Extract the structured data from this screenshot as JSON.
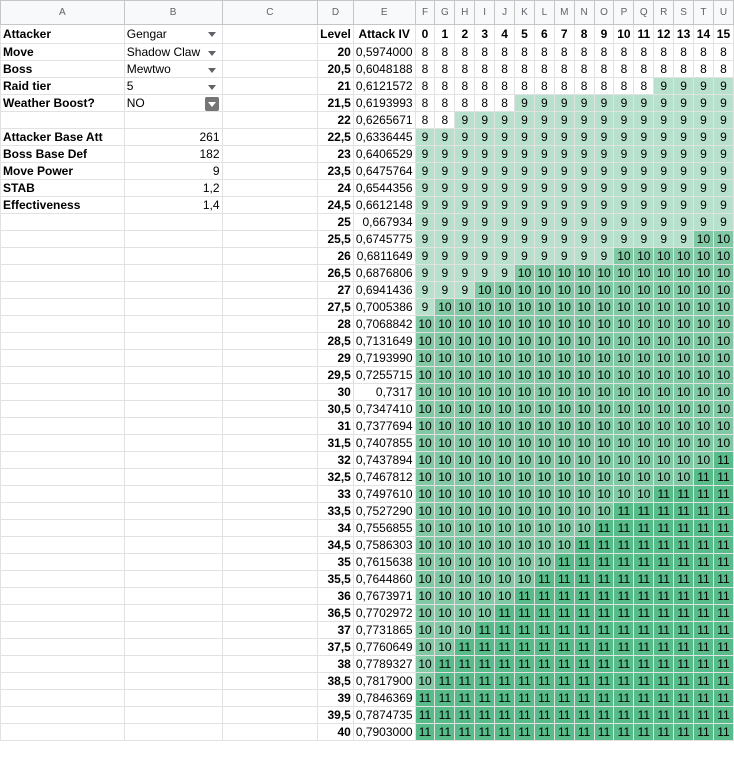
{
  "columns": [
    "A",
    "B",
    "C",
    "D",
    "E",
    "F",
    "G",
    "H",
    "I",
    "J",
    "K",
    "L",
    "M",
    "N",
    "O",
    "P",
    "Q",
    "R",
    "S",
    "T",
    "U"
  ],
  "params": [
    {
      "label": "Attacker",
      "value": "Gengar",
      "dropdown": true
    },
    {
      "label": "Move",
      "value": "Shadow Claw",
      "dropdown": true
    },
    {
      "label": "Boss",
      "value": "Mewtwo",
      "dropdown": true
    },
    {
      "label": "Raid tier",
      "value": "5",
      "dropdown": true
    },
    {
      "label": "Weather Boost?",
      "value": "NO",
      "dropdown": "boxed"
    },
    null,
    {
      "label": "Attacker Base Att",
      "value": "261",
      "numeric": true
    },
    {
      "label": "Boss Base Def",
      "value": "182",
      "numeric": true
    },
    {
      "label": "Move Power",
      "value": "9",
      "numeric": true
    },
    {
      "label": "STAB",
      "value": "1,2",
      "numeric": true
    },
    {
      "label": "Effectiveness",
      "value": "1,4",
      "numeric": true
    }
  ],
  "table_header": {
    "level": "Level",
    "multiplier": "Attack IV"
  },
  "iv_headers": [
    "0",
    "1",
    "2",
    "3",
    "4",
    "5",
    "6",
    "7",
    "8",
    "9",
    "10",
    "11",
    "12",
    "13",
    "14",
    "15"
  ],
  "thresholds": [
    16,
    16,
    12,
    5,
    2,
    0,
    0,
    0,
    0,
    0,
    0,
    0,
    0,
    0,
    0,
    0,
    0,
    0,
    0,
    0,
    0,
    0,
    0,
    0,
    0,
    0,
    0,
    0,
    0,
    0,
    0,
    0,
    0,
    0,
    0,
    0,
    0,
    0,
    0,
    0,
    0
  ],
  "thresholds_10": [
    16,
    16,
    16,
    16,
    16,
    16,
    16,
    16,
    16,
    16,
    16,
    14,
    10,
    5,
    3,
    1,
    0,
    0,
    0,
    0,
    0,
    0,
    0,
    0,
    0,
    0,
    0,
    0,
    0,
    0,
    0,
    0,
    0,
    0,
    0,
    0,
    0,
    0,
    0,
    0,
    0
  ],
  "thresholds_11": [
    16,
    16,
    16,
    16,
    16,
    16,
    16,
    16,
    16,
    16,
    16,
    16,
    16,
    16,
    16,
    16,
    16,
    16,
    16,
    16,
    16,
    16,
    16,
    16,
    15,
    14,
    12,
    10,
    9,
    8,
    7,
    6,
    5,
    4,
    3,
    2,
    1,
    1,
    0,
    0,
    0
  ],
  "rows": [
    {
      "level": "20",
      "mult": "0,5974000"
    },
    {
      "level": "20,5",
      "mult": "0,6048188"
    },
    {
      "level": "21",
      "mult": "0,6121572"
    },
    {
      "level": "21,5",
      "mult": "0,6193993"
    },
    {
      "level": "22",
      "mult": "0,6265671"
    },
    {
      "level": "22,5",
      "mult": "0,6336445"
    },
    {
      "level": "23",
      "mult": "0,6406529"
    },
    {
      "level": "23,5",
      "mult": "0,6475764"
    },
    {
      "level": "24",
      "mult": "0,6544356"
    },
    {
      "level": "24,5",
      "mult": "0,6612148"
    },
    {
      "level": "25",
      "mult": "0,667934"
    },
    {
      "level": "25,5",
      "mult": "0,6745775"
    },
    {
      "level": "26",
      "mult": "0,6811649"
    },
    {
      "level": "26,5",
      "mult": "0,6876806"
    },
    {
      "level": "27",
      "mult": "0,6941436"
    },
    {
      "level": "27,5",
      "mult": "0,7005386"
    },
    {
      "level": "28",
      "mult": "0,7068842"
    },
    {
      "level": "28,5",
      "mult": "0,7131649"
    },
    {
      "level": "29",
      "mult": "0,7193990"
    },
    {
      "level": "29,5",
      "mult": "0,7255715"
    },
    {
      "level": "30",
      "mult": "0,7317"
    },
    {
      "level": "30,5",
      "mult": "0,7347410"
    },
    {
      "level": "31",
      "mult": "0,7377694"
    },
    {
      "level": "31,5",
      "mult": "0,7407855"
    },
    {
      "level": "32",
      "mult": "0,7437894"
    },
    {
      "level": "32,5",
      "mult": "0,7467812"
    },
    {
      "level": "33",
      "mult": "0,7497610"
    },
    {
      "level": "33,5",
      "mult": "0,7527290"
    },
    {
      "level": "34",
      "mult": "0,7556855"
    },
    {
      "level": "34,5",
      "mult": "0,7586303"
    },
    {
      "level": "35",
      "mult": "0,7615638"
    },
    {
      "level": "35,5",
      "mult": "0,7644860"
    },
    {
      "level": "36",
      "mult": "0,7673971"
    },
    {
      "level": "36,5",
      "mult": "0,7702972"
    },
    {
      "level": "37",
      "mult": "0,7731865"
    },
    {
      "level": "37,5",
      "mult": "0,7760649"
    },
    {
      "level": "38",
      "mult": "0,7789327"
    },
    {
      "level": "38,5",
      "mult": "0,7817900"
    },
    {
      "level": "39",
      "mult": "0,7846369"
    },
    {
      "level": "39,5",
      "mult": "0,7874735"
    },
    {
      "level": "40",
      "mult": "0,7903000"
    }
  ],
  "colors": {
    "v8": "#ffffff",
    "v9": "#b7e1cd",
    "v10": "#80c9a4",
    "v11": "#57bb8a",
    "gridline": "#e2e2e2",
    "header_bg": "#f8f9fa"
  }
}
